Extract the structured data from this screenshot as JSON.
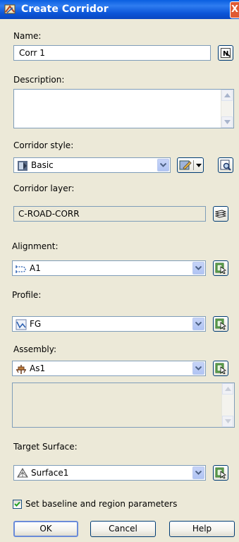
{
  "window": {
    "title": "Create Corridor",
    "close_glyph": "X"
  },
  "name": {
    "label": "Name:",
    "value": "Corr 1"
  },
  "description": {
    "label": "Description:",
    "value": ""
  },
  "corridor_style": {
    "label": "Corridor style:",
    "value": "Basic"
  },
  "corridor_layer": {
    "label": "Corridor layer:",
    "value": "C-ROAD-CORR"
  },
  "alignment": {
    "label": "Alignment:",
    "value": "A1"
  },
  "profile": {
    "label": "Profile:",
    "value": "FG"
  },
  "assembly": {
    "label": "Assembly:",
    "value": "As1"
  },
  "target_surface": {
    "label": "Target Surface:",
    "value": "Surface1"
  },
  "set_baseline": {
    "label": "Set baseline and region parameters",
    "checked": true
  },
  "buttons": {
    "ok": "OK",
    "cancel": "Cancel",
    "help": "Help"
  },
  "colors": {
    "titlebar": "#0A5FE0",
    "dialog_bg": "#ECE9D8",
    "field_border": "#7F9DB9",
    "button_border": "#003C74"
  }
}
